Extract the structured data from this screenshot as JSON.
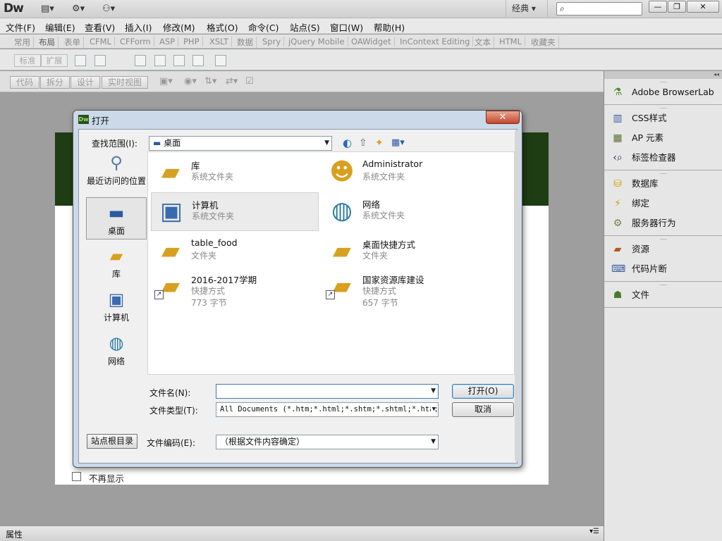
{
  "app": {
    "logo": "Dw",
    "workspace": "经典",
    "search_placeholder": "",
    "min_label": "—",
    "restore_label": "❐",
    "close_label": "✕"
  },
  "menu": [
    "文件(F)",
    "编辑(E)",
    "查看(V)",
    "插入(I)",
    "修改(M)",
    "格式(O)",
    "命令(C)",
    "站点(S)",
    "窗口(W)",
    "帮助(H)"
  ],
  "insert_tabs": [
    "常用",
    "布局",
    "表单",
    "CFML",
    "CFForm",
    "ASP",
    "PHP",
    "XSLT",
    "数据",
    "Spry",
    "jQuery Mobile",
    "OAWidget",
    "InContext Editing",
    "文本",
    "HTML",
    "收藏夹"
  ],
  "insert_bar": {
    "standard": "标准",
    "expanded": "扩展"
  },
  "view_buttons": [
    "代码",
    "拆分",
    "设计",
    "实时视图"
  ],
  "welcome": {
    "no_show": "不再显示"
  },
  "property_bar": "属性",
  "panel": {
    "groups": [
      [
        {
          "label": "Adobe BrowserLab",
          "icon": "flask-icon"
        }
      ],
      [
        {
          "label": "CSS样式",
          "icon": "css-styles-icon"
        },
        {
          "label": "AP 元素",
          "icon": "ap-elements-icon"
        },
        {
          "label": "标签检查器",
          "icon": "tag-inspector-icon"
        }
      ],
      [
        {
          "label": "数据库",
          "icon": "database-icon"
        },
        {
          "label": "绑定",
          "icon": "bindings-icon"
        },
        {
          "label": "服务器行为",
          "icon": "server-behaviors-icon"
        }
      ],
      [
        {
          "label": "资源",
          "icon": "assets-icon"
        },
        {
          "label": "代码片断",
          "icon": "snippets-icon"
        }
      ],
      [
        {
          "label": "文件",
          "icon": "files-icon"
        }
      ]
    ]
  },
  "dialog": {
    "title": "打开",
    "look_in_label": "查找范围(I):",
    "look_in_value": "桌面",
    "places": [
      {
        "label": "最近访问的位置",
        "icon": "recent-places-icon"
      },
      {
        "label": "桌面",
        "icon": "desktop-icon"
      },
      {
        "label": "库",
        "icon": "libraries-icon"
      },
      {
        "label": "计算机",
        "icon": "computer-icon"
      },
      {
        "label": "网络",
        "icon": "network-icon"
      }
    ],
    "files": [
      {
        "name": "库",
        "type": "系统文件夹",
        "size": "",
        "icon": "libraries-icon"
      },
      {
        "name": "Administrator",
        "type": "系统文件夹",
        "size": "",
        "icon": "user-folder-icon"
      },
      {
        "name": "计算机",
        "type": "系统文件夹",
        "size": "",
        "icon": "computer-icon"
      },
      {
        "name": "网络",
        "type": "系统文件夹",
        "size": "",
        "icon": "network-icon"
      },
      {
        "name": "table_food",
        "type": "文件夹",
        "size": "",
        "icon": "folder-icon"
      },
      {
        "name": "桌面快捷方式",
        "type": "文件夹",
        "size": "",
        "icon": "folder-icon"
      },
      {
        "name": "2016-2017学期",
        "type": "快捷方式",
        "size": "773 字节",
        "icon": "shortcut-folder-icon"
      },
      {
        "name": "国家资源库建设",
        "type": "快捷方式",
        "size": "657 字节",
        "icon": "shortcut-folder-icon"
      }
    ],
    "filename_label": "文件名(N):",
    "filename_value": "",
    "filetype_label": "文件类型(T):",
    "filetype_value": "All Documents (*.htm;*.html;*.shtm;*.shtml;*.hta;",
    "open_button": "打开(O)",
    "cancel_button": "取消",
    "site_root_button": "站点根目录",
    "encoding_label": "文件编码(E):",
    "encoding_value": "（根据文件内容确定）"
  }
}
